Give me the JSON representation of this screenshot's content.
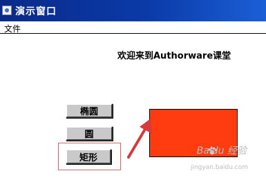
{
  "window": {
    "title": "演示窗口",
    "icon": "app-icon"
  },
  "menubar": {
    "items": [
      "文件"
    ]
  },
  "content": {
    "welcome_text": "欢迎来到Authorware课堂",
    "buttons": {
      "ellipse": "椭圆",
      "circle": "圆",
      "rectangle": "矩形"
    },
    "shape_color": "#ff3b10"
  },
  "annotation": {
    "highlight_color": "#c87070",
    "arrow_color": "#d63a3a"
  },
  "watermark": {
    "text": "Baidu 经验",
    "url": "jingyan.baidu.com"
  }
}
